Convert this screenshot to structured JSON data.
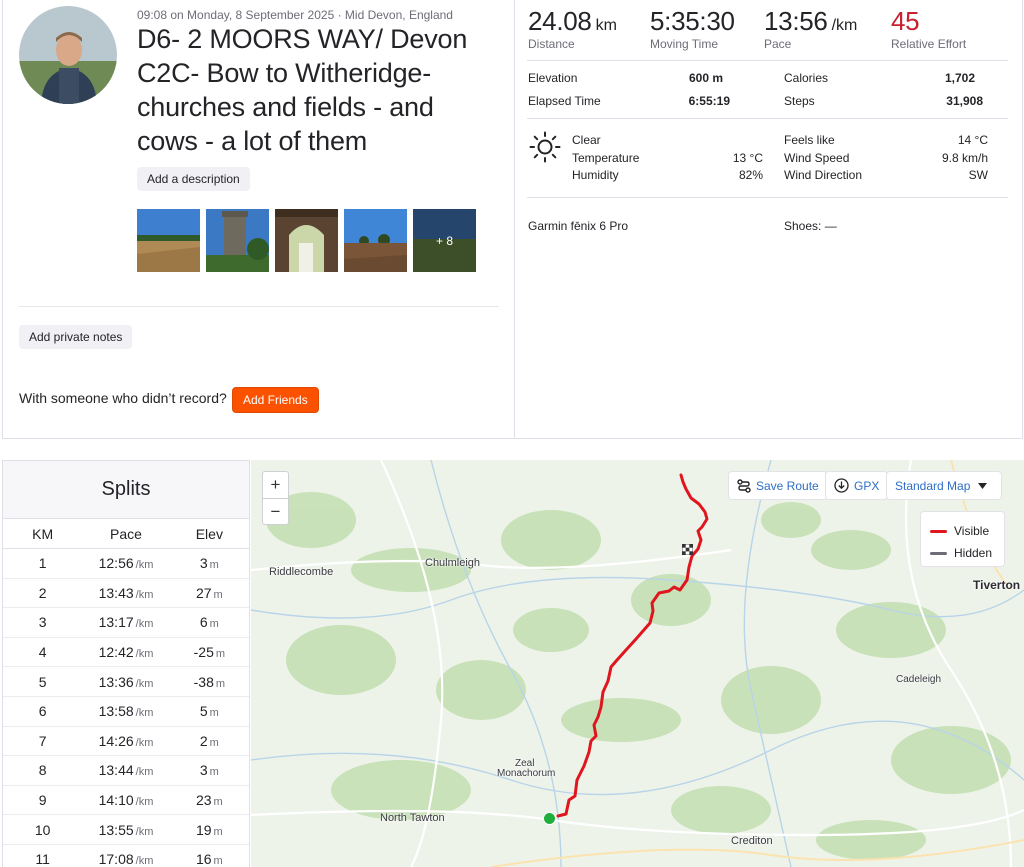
{
  "activity": {
    "meta": "09:08 on Monday, 8 September 2025 · Mid Devon, England",
    "title": "D6- 2 MOORS WAY/ Devon C2C- Bow to Witheridge- churches and fields - and cows - a lot of them",
    "add_description": "Add a description",
    "more_photos": "+ 8",
    "add_private_notes": "Add private notes",
    "with_someone": "With someone who didn’t record?",
    "add_friends": "Add Friends"
  },
  "stats": {
    "distance": {
      "value": "24.08",
      "unit": "km",
      "label": "Distance"
    },
    "moving_time": {
      "value": "5:35:30",
      "label": "Moving Time"
    },
    "pace": {
      "value": "13:56",
      "unit": "/km",
      "label": "Pace"
    },
    "relative_effort": {
      "value": "45",
      "label": "Relative Effort"
    }
  },
  "details": {
    "elevation_label": "Elevation",
    "elevation": "600 m",
    "calories_label": "Calories",
    "calories": "1,702",
    "elapsed_label": "Elapsed Time",
    "elapsed": "6:55:19",
    "steps_label": "Steps",
    "steps": "31,908"
  },
  "weather": {
    "icon": "sun-icon",
    "condition": "Clear",
    "temperature_label": "Temperature",
    "temperature": "13 °C",
    "humidity_label": "Humidity",
    "humidity": "82%",
    "feels_like_label": "Feels like",
    "feels_like": "14 °C",
    "wind_speed_label": "Wind Speed",
    "wind_speed": "9.8 km/h",
    "wind_direction_label": "Wind Direction",
    "wind_direction": "SW"
  },
  "gear": {
    "device": "Garmin fēnix 6 Pro",
    "shoes": "Shoes: —"
  },
  "splits": {
    "title": "Splits",
    "headers": {
      "km": "KM",
      "pace": "Pace",
      "elev": "Elev"
    },
    "pace_unit": "/km",
    "elev_unit": "m",
    "rows": [
      {
        "km": "1",
        "pace": "12:56",
        "elev": "3"
      },
      {
        "km": "2",
        "pace": "13:43",
        "elev": "27"
      },
      {
        "km": "3",
        "pace": "13:17",
        "elev": "6"
      },
      {
        "km": "4",
        "pace": "12:42",
        "elev": "-25"
      },
      {
        "km": "5",
        "pace": "13:36",
        "elev": "-38"
      },
      {
        "km": "6",
        "pace": "13:58",
        "elev": "5"
      },
      {
        "km": "7",
        "pace": "14:26",
        "elev": "2"
      },
      {
        "km": "8",
        "pace": "13:44",
        "elev": "3"
      },
      {
        "km": "9",
        "pace": "14:10",
        "elev": "23"
      },
      {
        "km": "10",
        "pace": "13:55",
        "elev": "19"
      },
      {
        "km": "11",
        "pace": "17:08",
        "elev": "16"
      }
    ]
  },
  "map": {
    "zoom_in": "+",
    "zoom_out": "−",
    "save_route": "Save Route",
    "gpx": "GPX",
    "map_style": "Standard Map",
    "legend": {
      "visible": "Visible",
      "hidden": "Hidden"
    },
    "places": {
      "riddlecombe": "Riddlecombe",
      "chulmleigh": "Chulmleigh",
      "tiverton": "Tiverton",
      "cadeleigh": "Cadeleigh",
      "zeal1": "Zeal",
      "zeal2": "Monachorum",
      "north_tawton": "North Tawton",
      "crediton": "Crediton"
    },
    "colors": {
      "route": "#e0161e",
      "start": "#1fae3b",
      "hidden": "#6d6d78",
      "accent": "#fc5200"
    }
  }
}
